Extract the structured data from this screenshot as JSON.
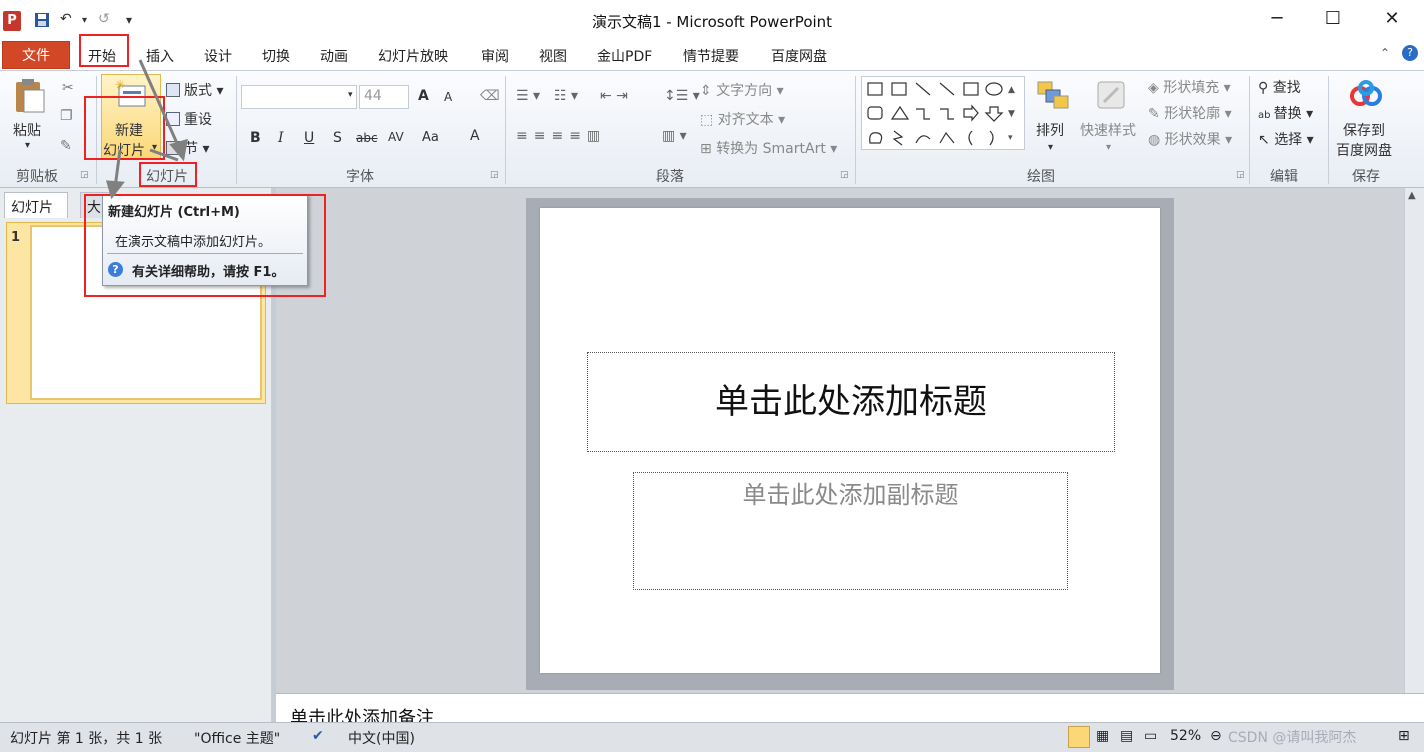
{
  "titlebar": {
    "app_icon": "P",
    "title": "演示文稿1 - Microsoft PowerPoint",
    "undo_icon": "↶",
    "redo_icon": "↺",
    "customize_icon": "▾"
  },
  "window": {
    "minimize": "─",
    "maximize": "☐",
    "close": "✕"
  },
  "tabs": {
    "file": "文件",
    "items": [
      "开始",
      "插入",
      "设计",
      "切换",
      "动画",
      "幻灯片放映",
      "审阅",
      "视图",
      "金山PDF",
      "情节提要",
      "百度网盘"
    ]
  },
  "ribbon": {
    "clipboard": {
      "paste": "粘贴",
      "label": "剪贴板"
    },
    "slides": {
      "new_line1": "新建",
      "new_line2": "幻灯片",
      "layout": "版式",
      "reset": "重设",
      "section": "节",
      "label": "幻灯片"
    },
    "font": {
      "size": "44",
      "label": "字体",
      "buttons": [
        "B",
        "I",
        "U",
        "S",
        "abc",
        "AV",
        "Aa",
        "A"
      ],
      "grow": "A",
      "shrink": "A"
    },
    "paragraph": {
      "text_direction": "文字方向",
      "align_text": "对齐文本",
      "smartart": "转换为 SmartArt",
      "label": "段落"
    },
    "drawing": {
      "arrange": "排列",
      "quick_styles": "快速样式",
      "fill": "形状填充",
      "outline": "形状轮廓",
      "effects": "形状效果",
      "label": "绘图"
    },
    "editing": {
      "find": "查找",
      "replace": "替换",
      "select": "选择",
      "label": "编辑"
    },
    "save": {
      "line1": "保存到",
      "line2": "百度网盘",
      "label": "保存"
    }
  },
  "tooltip": {
    "title": "新建幻灯片 (Ctrl+M)",
    "body": "在演示文稿中添加幻灯片。",
    "help": "有关详细帮助，请按 F1。"
  },
  "left_panel": {
    "tab_slides": "幻灯片",
    "tab_outline": "大",
    "slide_number": "1"
  },
  "slide": {
    "title_placeholder": "单击此处添加标题",
    "subtitle_placeholder": "单击此处添加副标题"
  },
  "notes": {
    "placeholder": "单击此处添加备注"
  },
  "status": {
    "slide_info": "幻灯片 第 1 张，共 1 张",
    "theme": "\"Office 主题\"",
    "language": "中文(中国)",
    "zoom": "52%"
  },
  "watermark": "CSDN @请叫我阿杰",
  "colors": {
    "file_tab": "#d24726",
    "highlight_box": "#ee2222",
    "selected_thumb": "#fde6a4"
  }
}
